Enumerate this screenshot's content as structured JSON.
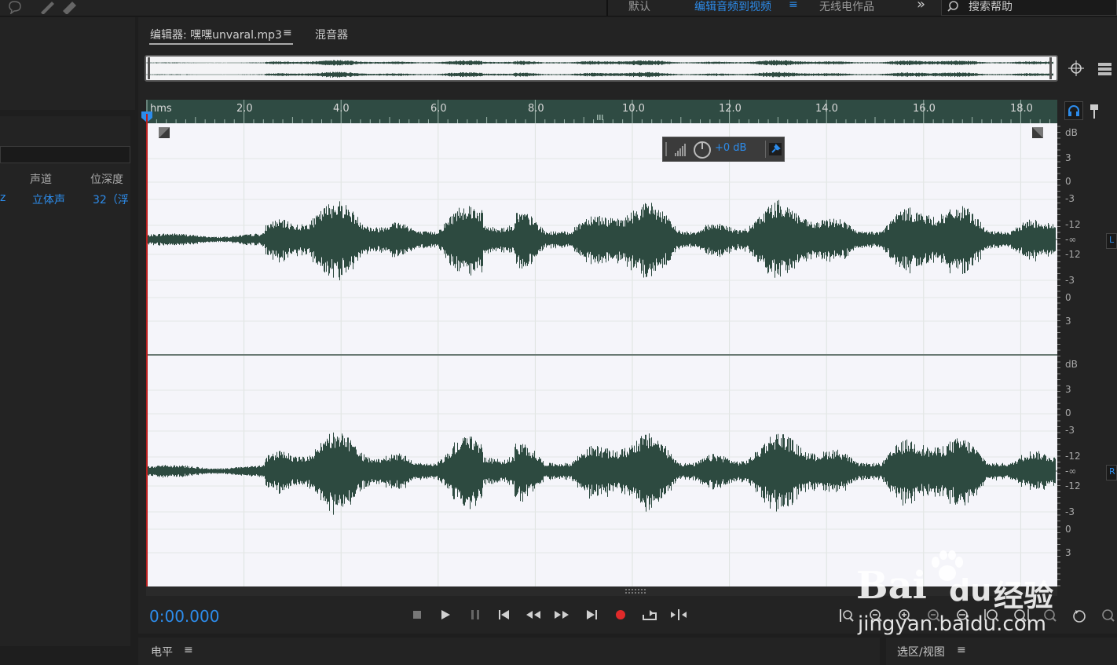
{
  "top_bar": {
    "workspaces": [
      "默认",
      "编辑音频到视频",
      "无线电作品"
    ],
    "active_workspace": "编辑音频到视频",
    "more_label": "»",
    "search_placeholder": "搜索帮助"
  },
  "files_panel": {
    "columns": [
      "声道",
      "位深度"
    ],
    "row": {
      "rate_tail": "z",
      "channels": "立体声",
      "bit_depth": "32（浮"
    }
  },
  "editor": {
    "tabs": [
      {
        "label": "编辑器: 嘿嘿unvaral.mp3",
        "active": true
      },
      {
        "label": "混音器",
        "active": false
      }
    ],
    "menu_icon": "≡",
    "ruler": {
      "unit": "hms",
      "ticks": [
        "2.0",
        "4.0",
        "6.0",
        "8.0",
        "10.0",
        "12.0",
        "14.0",
        "16.0",
        "18.0"
      ]
    },
    "db_scale": {
      "unit": "dB",
      "left_channel": [
        "3",
        "0",
        "-3",
        "-12",
        "-∞",
        "-12",
        "-3",
        "0",
        "3"
      ],
      "right_channel": [
        "3",
        "0",
        "-3",
        "-12",
        "-∞",
        "-12",
        "-3",
        "0",
        "3"
      ]
    },
    "channel_labels": [
      "L",
      "R"
    ],
    "hud": {
      "volume": "+0 dB"
    },
    "timecode": "0:00.000"
  },
  "transport": [
    "stop",
    "play",
    "pause",
    "go-to-start",
    "rewind",
    "fast-forward",
    "go-to-end",
    "record",
    "loop",
    "skip-selection"
  ],
  "bottom_panels": {
    "levels": "电平",
    "selection_view": "选区/视图"
  },
  "watermark": {
    "brand": "Bai",
    "brand2": "du",
    "product": "经验",
    "url": "jingyan.baidu.com"
  },
  "colors": {
    "accent": "#2d8ceb",
    "waveform": "#2d4a40",
    "record": "#e02a2a",
    "ruler_bg": "#2f4b43"
  }
}
